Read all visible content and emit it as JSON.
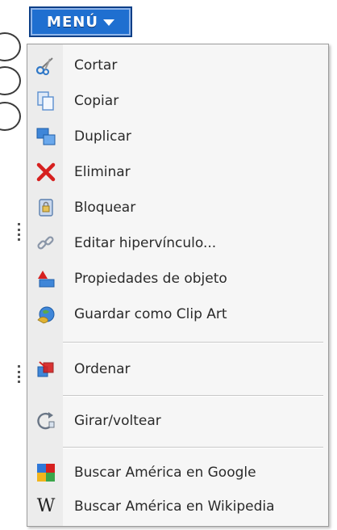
{
  "menu_button": {
    "label": "MENÚ"
  },
  "menu": {
    "group1": [
      {
        "label": "Cortar",
        "icon": "scissors-icon"
      },
      {
        "label": "Copiar",
        "icon": "copy-icon"
      },
      {
        "label": "Duplicar",
        "icon": "duplicate-icon"
      },
      {
        "label": "Eliminar",
        "icon": "delete-icon"
      },
      {
        "label": "Bloquear",
        "icon": "lock-icon"
      },
      {
        "label": "Editar hipervínculo...",
        "icon": "link-icon"
      },
      {
        "label": "Propiedades de objeto",
        "icon": "properties-icon"
      },
      {
        "label": "Guardar como Clip Art",
        "icon": "clipart-icon"
      }
    ],
    "group2": [
      {
        "label": "Ordenar",
        "icon": "arrange-icon"
      }
    ],
    "group3": [
      {
        "label": "Girar/voltear",
        "icon": "rotate-icon"
      }
    ],
    "group4": [
      {
        "label": "Buscar América en Google",
        "icon": "google-icon"
      },
      {
        "label": "Buscar América en Wikipedia",
        "icon": "wikipedia-icon"
      }
    ]
  },
  "colors": {
    "button_bg": "#1f6fd0",
    "delete_red": "#d6201f",
    "text": "#2a2a2a"
  }
}
